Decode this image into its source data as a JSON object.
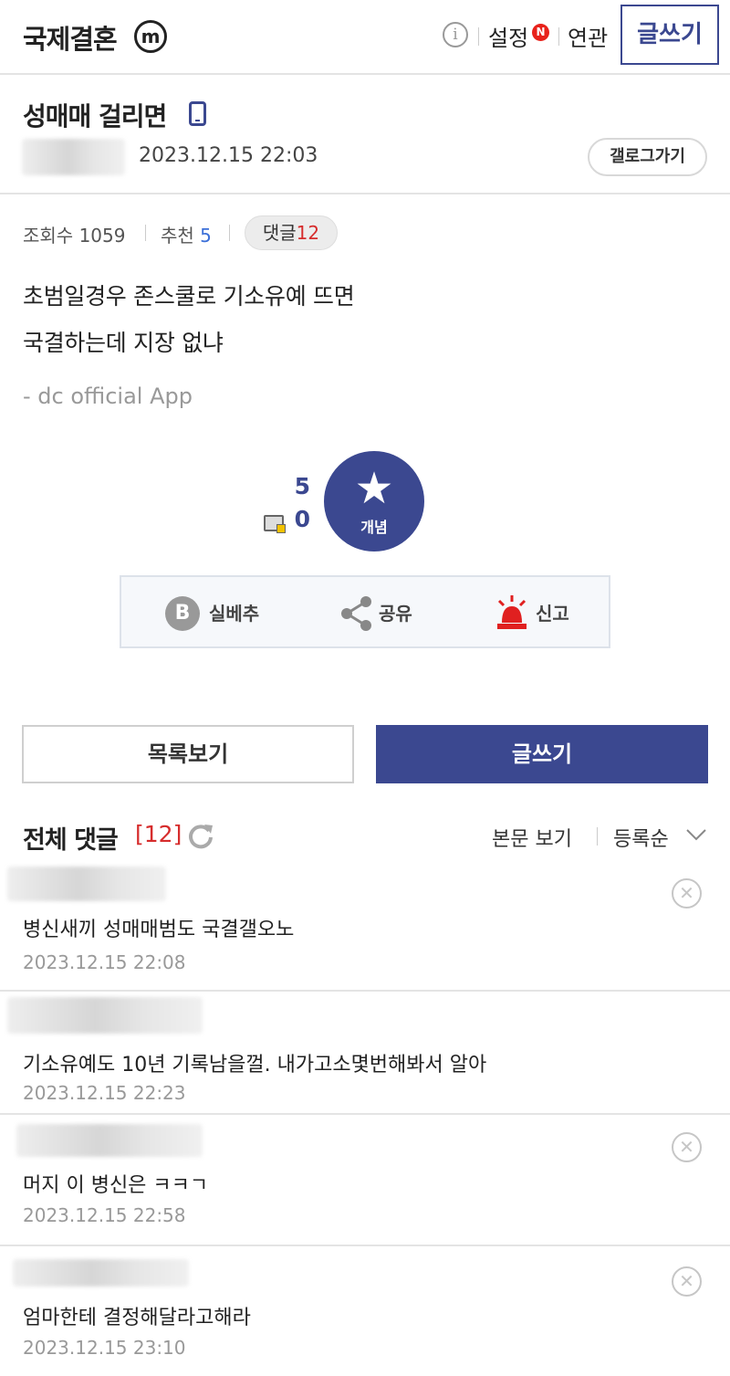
{
  "header": {
    "gallery_name": "국제결혼",
    "minor_badge": "m",
    "info_icon": "info-icon",
    "settings_label": "설정",
    "new_badge": "N",
    "related_label": "연관",
    "write_label": "글쓰기"
  },
  "post": {
    "title": "성매매 걸리면",
    "device_icon": "mobile-phone-icon",
    "datetime": "2023.12.15 22:03",
    "go_gallery_label": "갤로그가기",
    "views_label": "조회수",
    "views": "1059",
    "recommend_label": "추천",
    "recommend": "5",
    "comments_label": "댓글",
    "comments": "12",
    "body_lines": [
      "초범일경우 존스쿨로 기소유예 뜨면",
      "국결하는데 지장 없냐"
    ],
    "signature": "- dc official App"
  },
  "recommend_box": {
    "up_count": "5",
    "down_count": "0",
    "button_label": "개념",
    "actions": [
      {
        "label": "실베추",
        "icon": "best-b-icon"
      },
      {
        "label": "공유",
        "icon": "share-icon"
      },
      {
        "label": "신고",
        "icon": "siren-icon"
      }
    ]
  },
  "buttons": {
    "list_label": "목록보기",
    "write_label": "글쓰기"
  },
  "comments_section": {
    "title": "전체 댓글",
    "count": "[12]",
    "view_body_label": "본문 보기",
    "sort_label": "등록순",
    "items": [
      {
        "text": "병신새끼 성매매범도 국결갤오노",
        "date": "2023.12.15 22:08",
        "deletable": true
      },
      {
        "text": "기소유예도 10년 기록남을껄. 내가고소몇번해봐서 알아",
        "date": "2023.12.15 22:23",
        "deletable": false
      },
      {
        "text": "머지 이 병신은 ㅋㅋㄱ",
        "date": "2023.12.15 22:58",
        "deletable": true
      },
      {
        "text": "엄마한테 결정해달라고해라",
        "date": "2023.12.15 23:10",
        "deletable": true
      }
    ]
  },
  "colors": {
    "brand": "#3b4890",
    "accent_red": "#d62c2c",
    "link_blue": "#3b6fd8"
  }
}
